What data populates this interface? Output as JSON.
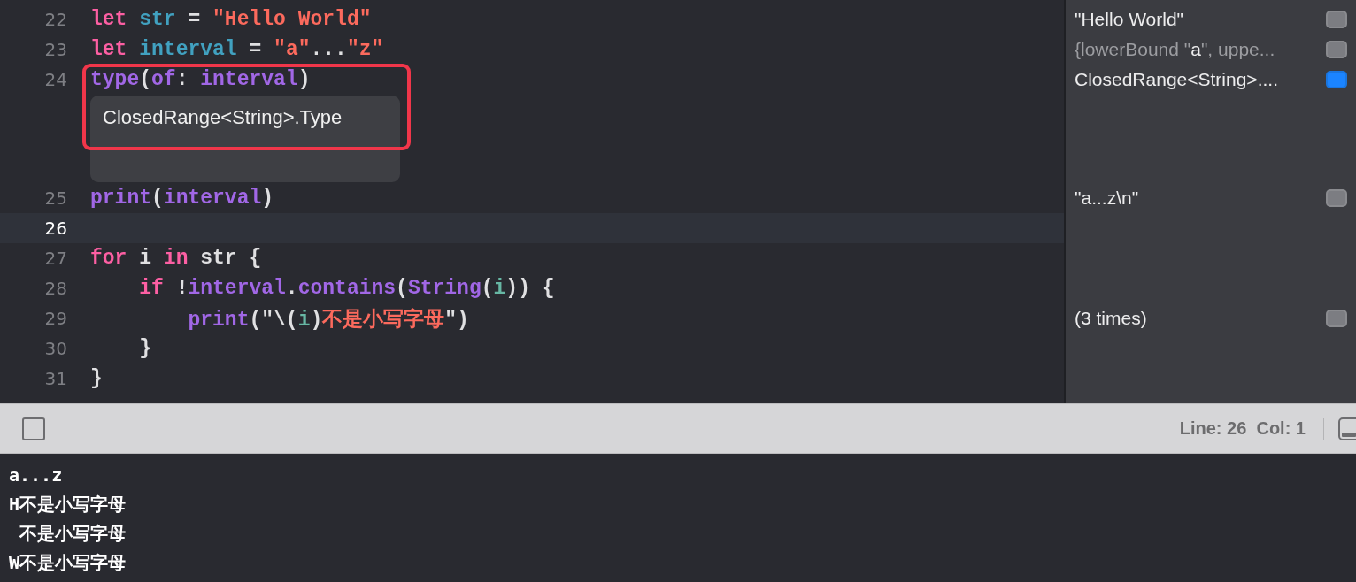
{
  "editor": {
    "lines": [
      {
        "number": "22",
        "current": false,
        "tokens": [
          {
            "kind": "keyword",
            "text": "let"
          },
          {
            "kind": "decl",
            "text": " str"
          },
          {
            "kind": "plain",
            "text": " = "
          },
          {
            "kind": "string",
            "text": "\"Hello World\""
          }
        ],
        "result": {
          "selected": false,
          "segments": [
            {
              "text": "\"Hello World\"",
              "muted": false
            }
          ]
        }
      },
      {
        "number": "23",
        "current": false,
        "tokens": [
          {
            "kind": "keyword",
            "text": "let"
          },
          {
            "kind": "decl",
            "text": " interval"
          },
          {
            "kind": "plain",
            "text": " = "
          },
          {
            "kind": "string",
            "text": "\"a\""
          },
          {
            "kind": "plain",
            "text": "..."
          },
          {
            "kind": "string",
            "text": "\"z\""
          }
        ],
        "result": {
          "selected": false,
          "segments": [
            {
              "text": "{lowerBound \"",
              "muted": true
            },
            {
              "text": "a",
              "muted": false
            },
            {
              "text": "\", uppe...",
              "muted": true
            }
          ]
        }
      },
      {
        "number": "24",
        "current": false,
        "tokens": [
          {
            "kind": "func",
            "text": "type"
          },
          {
            "kind": "plain",
            "text": "("
          },
          {
            "kind": "func",
            "text": "of"
          },
          {
            "kind": "plain",
            "text": ": "
          },
          {
            "kind": "func",
            "text": "interval"
          },
          {
            "kind": "plain",
            "text": ")"
          }
        ],
        "result": {
          "selected": true,
          "segments": [
            {
              "text": "ClosedRange<String>....",
              "muted": false
            }
          ]
        },
        "popup": {
          "text": "ClosedRange<String>.Type",
          "outlined": true
        }
      },
      {
        "number": "25",
        "current": false,
        "tokens": [
          {
            "kind": "func",
            "text": "print"
          },
          {
            "kind": "plain",
            "text": "("
          },
          {
            "kind": "func",
            "text": "interval"
          },
          {
            "kind": "plain",
            "text": ")"
          }
        ],
        "result": {
          "selected": false,
          "segments": [
            {
              "text": "\"a...z\\n\"",
              "muted": false
            }
          ]
        }
      },
      {
        "number": "26",
        "current": true
      },
      {
        "number": "27",
        "current": false,
        "tokens": [
          {
            "kind": "keyword",
            "text": "for"
          },
          {
            "kind": "plain",
            "text": " i "
          },
          {
            "kind": "keyword",
            "text": "in"
          },
          {
            "kind": "plain",
            "text": " str {"
          }
        ]
      },
      {
        "number": "28",
        "current": false,
        "tokens": [
          {
            "kind": "keyword",
            "text": "    if"
          },
          {
            "kind": "plain",
            "text": " !"
          },
          {
            "kind": "func",
            "text": "interval"
          },
          {
            "kind": "plain",
            "text": "."
          },
          {
            "kind": "func",
            "text": "contains"
          },
          {
            "kind": "plain",
            "text": "("
          },
          {
            "kind": "func",
            "text": "String"
          },
          {
            "kind": "plain",
            "text": "("
          },
          {
            "kind": "param",
            "text": "i"
          },
          {
            "kind": "plain",
            "text": ")) {"
          }
        ]
      },
      {
        "number": "29",
        "current": false,
        "tokens": [
          {
            "kind": "func",
            "text": "        print"
          },
          {
            "kind": "plain",
            "text": "(\"\\("
          },
          {
            "kind": "param",
            "text": "i"
          },
          {
            "kind": "plain",
            "text": ")"
          },
          {
            "kind": "string",
            "text": "不是小写字母"
          },
          {
            "kind": "plain",
            "text": "\")"
          }
        ],
        "result": {
          "selected": false,
          "segments": [
            {
              "text": "(3 times)",
              "muted": false
            }
          ]
        }
      },
      {
        "number": "30",
        "current": false,
        "tokens": [
          {
            "kind": "plain",
            "text": "    }"
          }
        ]
      },
      {
        "number": "31",
        "current": false,
        "tokens": [
          {
            "kind": "plain",
            "text": "}"
          }
        ]
      }
    ]
  },
  "status_bar": {
    "position": "Line: 26  Col: 1"
  },
  "console": {
    "lines": [
      "a...z",
      "H不是小写字母",
      " 不是小写字母",
      "W不是小写字母"
    ]
  }
}
